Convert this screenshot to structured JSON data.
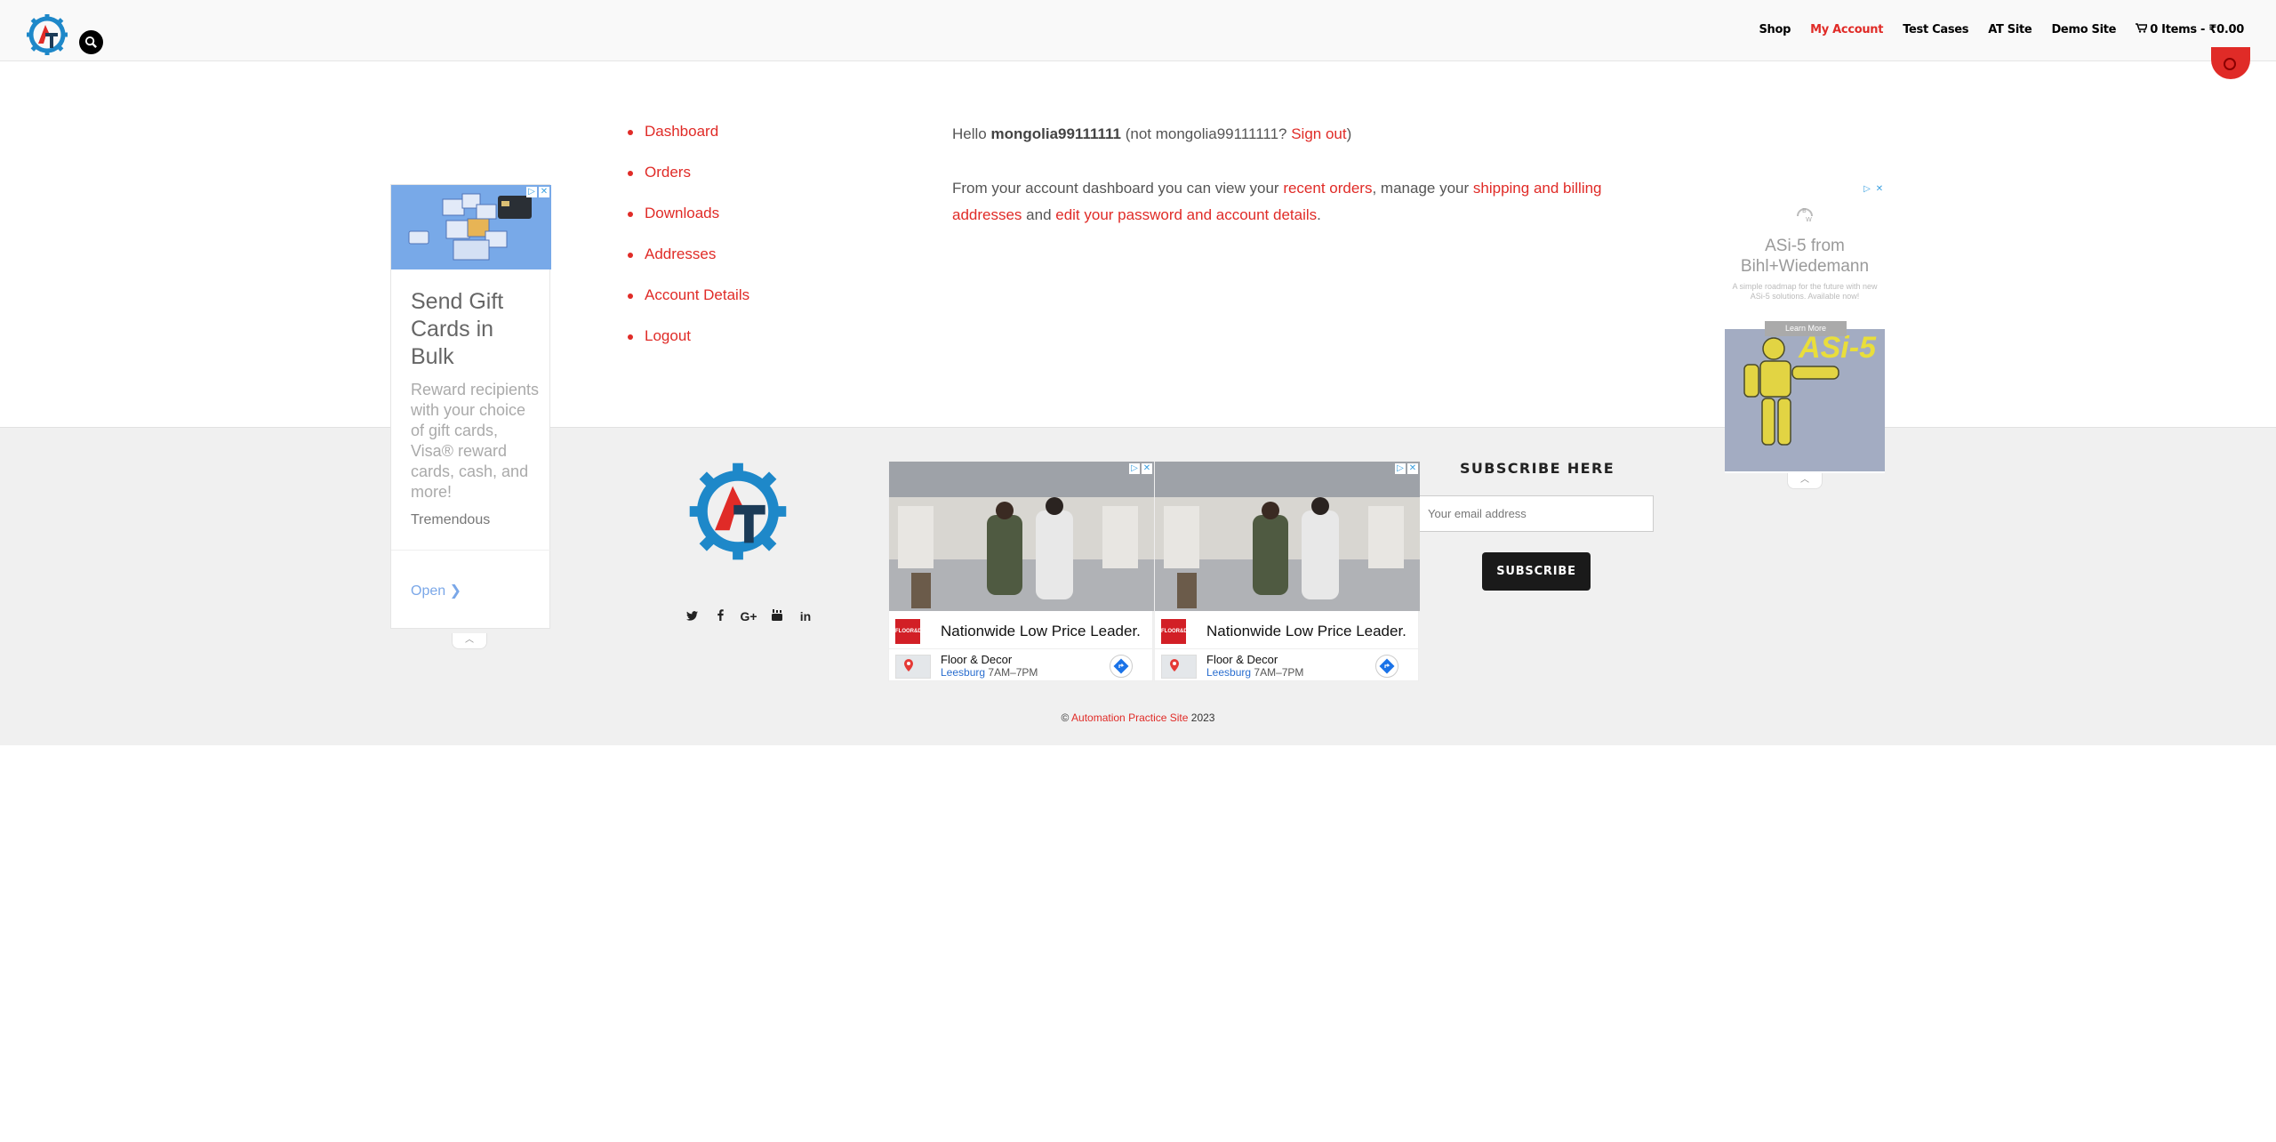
{
  "header": {
    "nav": [
      {
        "label": "Shop"
      },
      {
        "label": "My Account",
        "active": true
      },
      {
        "label": "Test Cases"
      },
      {
        "label": "AT Site"
      },
      {
        "label": "Demo Site"
      }
    ],
    "cart_label": "0 Items - ₹0.00"
  },
  "account_nav": [
    {
      "label": "Dashboard"
    },
    {
      "label": "Orders"
    },
    {
      "label": "Downloads"
    },
    {
      "label": "Addresses"
    },
    {
      "label": "Account Details"
    },
    {
      "label": "Logout"
    }
  ],
  "dashboard": {
    "hello": "Hello ",
    "username": "mongolia99111111",
    "not_text": " (not mongolia99111111? ",
    "sign_out": "Sign out",
    "close_paren": ")",
    "intro": "From your account dashboard you can view your ",
    "recent_orders": "recent orders",
    "manage": ", manage your ",
    "shipping_billing": "shipping and billing addresses",
    "and": " and ",
    "edit_password": "edit your password and account details",
    "period": "."
  },
  "footer": {
    "subscribe_title": "SUBSCRIBE HERE",
    "email_placeholder": "Your email address",
    "subscribe_button": "SUBSCRIBE",
    "copyright_prefix": "© ",
    "copyright_link": "Automation Practice Site",
    "copyright_year": " 2023",
    "social_icons": [
      "twitter-icon",
      "facebook-icon",
      "google-plus-icon",
      "youtube-icon",
      "linkedin-icon"
    ]
  },
  "ads": {
    "left": {
      "title": "Send Gift Cards in Bulk",
      "description": "Reward recipients with your choice of gift cards, Visa® reward cards, cash, and more!",
      "brand": "Tremendous",
      "cta": "Open"
    },
    "right": {
      "title": "ASi-5 from Bihl+Wiedemann",
      "subtitle": "A simple roadmap for the future with new ASi-5 solutions. Available now!",
      "cta": "Learn More",
      "image_text": "ASi-5"
    },
    "mid": {
      "headline": "Nationwide Low Price Leader.",
      "store": "Floor & Decor",
      "city": "Leesburg",
      "hours": "7AM–7PM",
      "logo_text": "FLOOR&DECOR"
    }
  },
  "colors": {
    "accent": "#e02b27",
    "logo_blue": "#1e88c9",
    "logo_navy": "#1c3b57",
    "footer_bg": "#f0f0f0"
  }
}
